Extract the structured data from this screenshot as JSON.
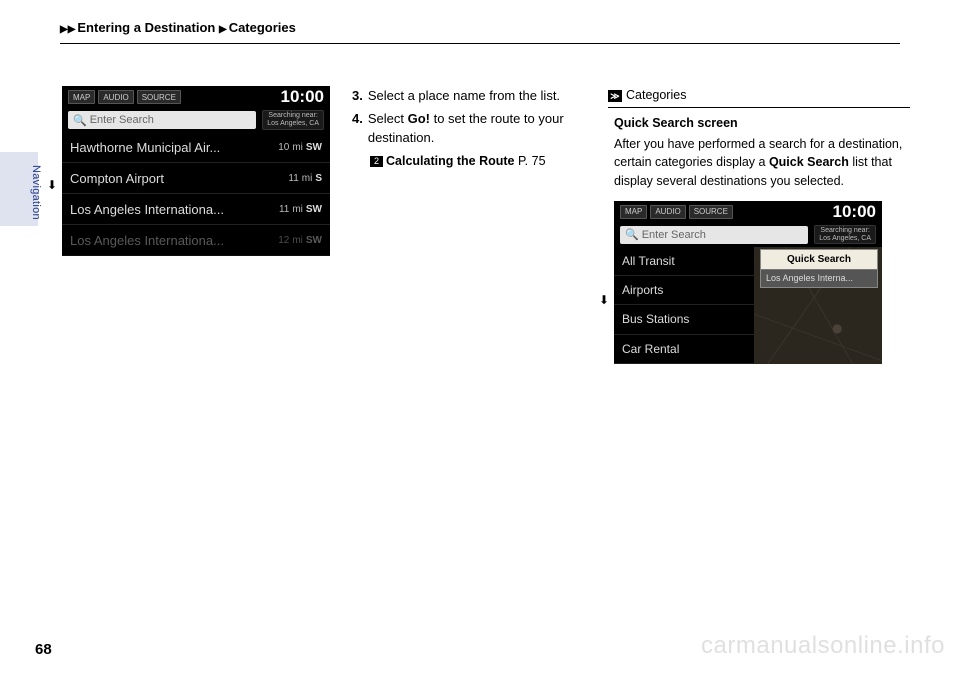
{
  "header": {
    "tri": "▶▶",
    "part1": "Entering a Destination",
    "tri2": "▶",
    "part2": "Categories"
  },
  "sideTab": "Navigation",
  "pageNum": "68",
  "watermark": "carmanualsonline.info",
  "shot1": {
    "topButtons": [
      "MAP",
      "AUDIO",
      "SOURCE"
    ],
    "time": "10:00",
    "searchPlaceholder": "Enter Search",
    "nearLine1": "Searching near:",
    "nearLine2": "Los Angeles, CA",
    "rows": [
      {
        "label": "Hawthorne Municipal Air...",
        "dist": "10",
        "unit": "mi",
        "dir": "SW"
      },
      {
        "label": "Compton Airport",
        "dist": "11",
        "unit": "mi",
        "dir": "S"
      },
      {
        "label": "Los Angeles Internationa...",
        "dist": "11",
        "unit": "mi",
        "dir": "SW"
      },
      {
        "label": "Los Angeles Internationa...",
        "dist": "12",
        "unit": "mi",
        "dir": "SW"
      }
    ]
  },
  "steps": {
    "s3num": "3.",
    "s3text": "Select a place name from the list.",
    "s4num": "4.",
    "s4text_a": "Select ",
    "s4text_b": "Go!",
    "s4text_c": " to set the route to your destination.",
    "xref_label": "Calculating the Route",
    "xref_page": " P. 75",
    "xicon": "2"
  },
  "col3": {
    "headIcon": "≫",
    "headText": "Categories",
    "title": "Quick Search screen",
    "line1a": "After you have performed a search for a destination, certain categories display a ",
    "line1b": "Quick Search",
    "line1c": " list that display several destinations you selected."
  },
  "shot2": {
    "topButtons": [
      "MAP",
      "AUDIO",
      "SOURCE"
    ],
    "time": "10:00",
    "searchPlaceholder": "Enter Search",
    "nearLine1": "Searching near:",
    "nearLine2": "Los Angeles, CA",
    "cats": [
      "All Transit",
      "Airports",
      "Bus Stations",
      "Car Rental"
    ],
    "qhead": "Quick Search",
    "qitem": "Los Angeles Interna..."
  }
}
